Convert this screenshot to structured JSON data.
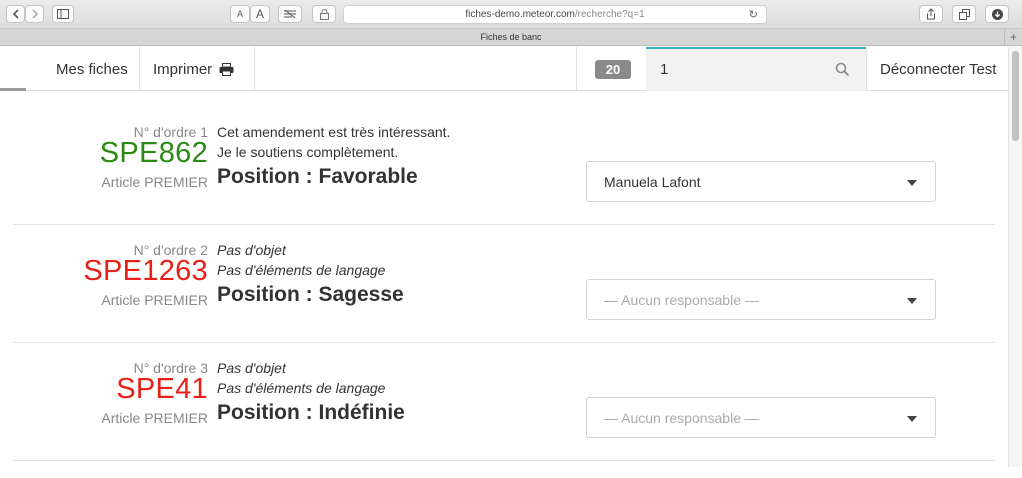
{
  "browser": {
    "url_host": "fiches-demo.meteor.com",
    "url_path": "/recherche?q=1",
    "tab_title": "Fiches de banc",
    "font_small": "A",
    "font_large": "A"
  },
  "navbar": {
    "mes_fiches": "Mes fiches",
    "imprimer": "Imprimer",
    "count_badge": "20",
    "search_value": "1",
    "logout": "Déconnecter Test"
  },
  "colors": {
    "green": "#2a8a12",
    "red": "#e8201a",
    "accent": "#3ab0c8"
  },
  "fiches": [
    {
      "ordre": "N° d'ordre 1",
      "numero": "SPE862",
      "numero_color": "green",
      "article": "Article PREMIER",
      "line1": "Cet amendement est très intéressant.",
      "line2": "Je le soutiens complètement.",
      "italic": false,
      "position": "Position : Favorable",
      "responsable": "Manuela Lafont",
      "responsable_placeholder": false
    },
    {
      "ordre": "N° d'ordre 2",
      "numero": "SPE1263",
      "numero_color": "red",
      "article": "Article PREMIER",
      "line1": "Pas d'objet",
      "line2": "Pas d'éléments de langage",
      "italic": true,
      "position": "Position : Sagesse",
      "responsable": "— Aucun responsable —",
      "responsable_placeholder": true
    },
    {
      "ordre": "N° d'ordre 3",
      "numero": "SPE41",
      "numero_color": "red",
      "article": "Article PREMIER",
      "line1": "Pas d'objet",
      "line2": "Pas d'éléments de langage",
      "italic": true,
      "position": "Position : Indéfinie",
      "responsable": "— Aucun responsable —",
      "responsable_placeholder": true
    }
  ]
}
